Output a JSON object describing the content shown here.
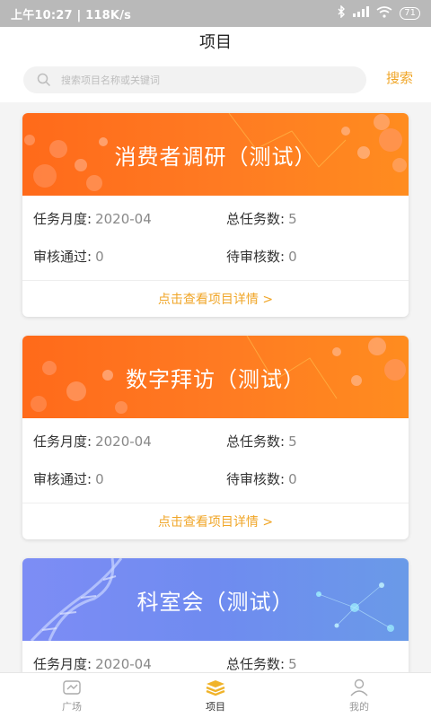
{
  "status_bar": {
    "time": "上午10:27 | 118K/s",
    "battery": "71"
  },
  "header": {
    "title": "项目"
  },
  "search": {
    "placeholder": "搜索项目名称或关键词",
    "button_label": "搜索"
  },
  "labels": {
    "month": "任务月度:",
    "total": "总任务数:",
    "approved": "审核通过:",
    "pending": "待审核数:",
    "detail_link": "点击查看项目详情 >"
  },
  "projects": [
    {
      "title": "消费者调研（测试）",
      "month": "2020-04",
      "total": "5",
      "approved": "0",
      "pending": "0",
      "theme": "orange"
    },
    {
      "title": "数字拜访（测试）",
      "month": "2020-04",
      "total": "5",
      "approved": "0",
      "pending": "0",
      "theme": "orange"
    },
    {
      "title": "科室会（测试）",
      "month": "2020-04",
      "total": "5",
      "theme": "blue"
    }
  ],
  "tabs": [
    {
      "label": "广场",
      "icon": "plaza-icon",
      "active": false
    },
    {
      "label": "项目",
      "icon": "project-stack-icon",
      "active": true
    },
    {
      "label": "我的",
      "icon": "user-icon",
      "active": false
    }
  ],
  "colors": {
    "accent": "#f0a628",
    "orange_banner": "#ff7a22",
    "blue_banner": "#7d8df5"
  }
}
